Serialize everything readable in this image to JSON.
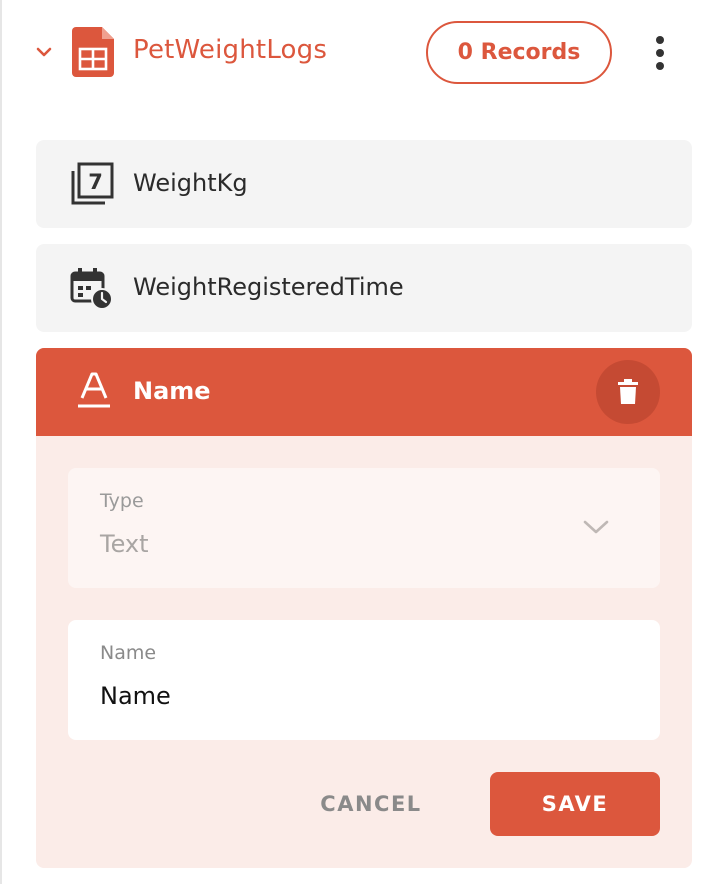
{
  "table": {
    "name": "PetWeightLogs",
    "records_label": "0 Records",
    "icon": "table-sheet-icon",
    "accent_color": "#dc573d"
  },
  "fields": [
    {
      "label": "WeightKg",
      "icon": "number-field-icon"
    },
    {
      "label": "WeightRegisteredTime",
      "icon": "calendar-clock-icon"
    }
  ],
  "editing_field": {
    "label": "Name",
    "icon": "text-field-icon",
    "type_label": "Type",
    "type_value": "Text",
    "name_label": "Name",
    "name_value": "Name",
    "cancel_label": "CANCEL",
    "save_label": "SAVE"
  },
  "number_icon_digit": "7"
}
